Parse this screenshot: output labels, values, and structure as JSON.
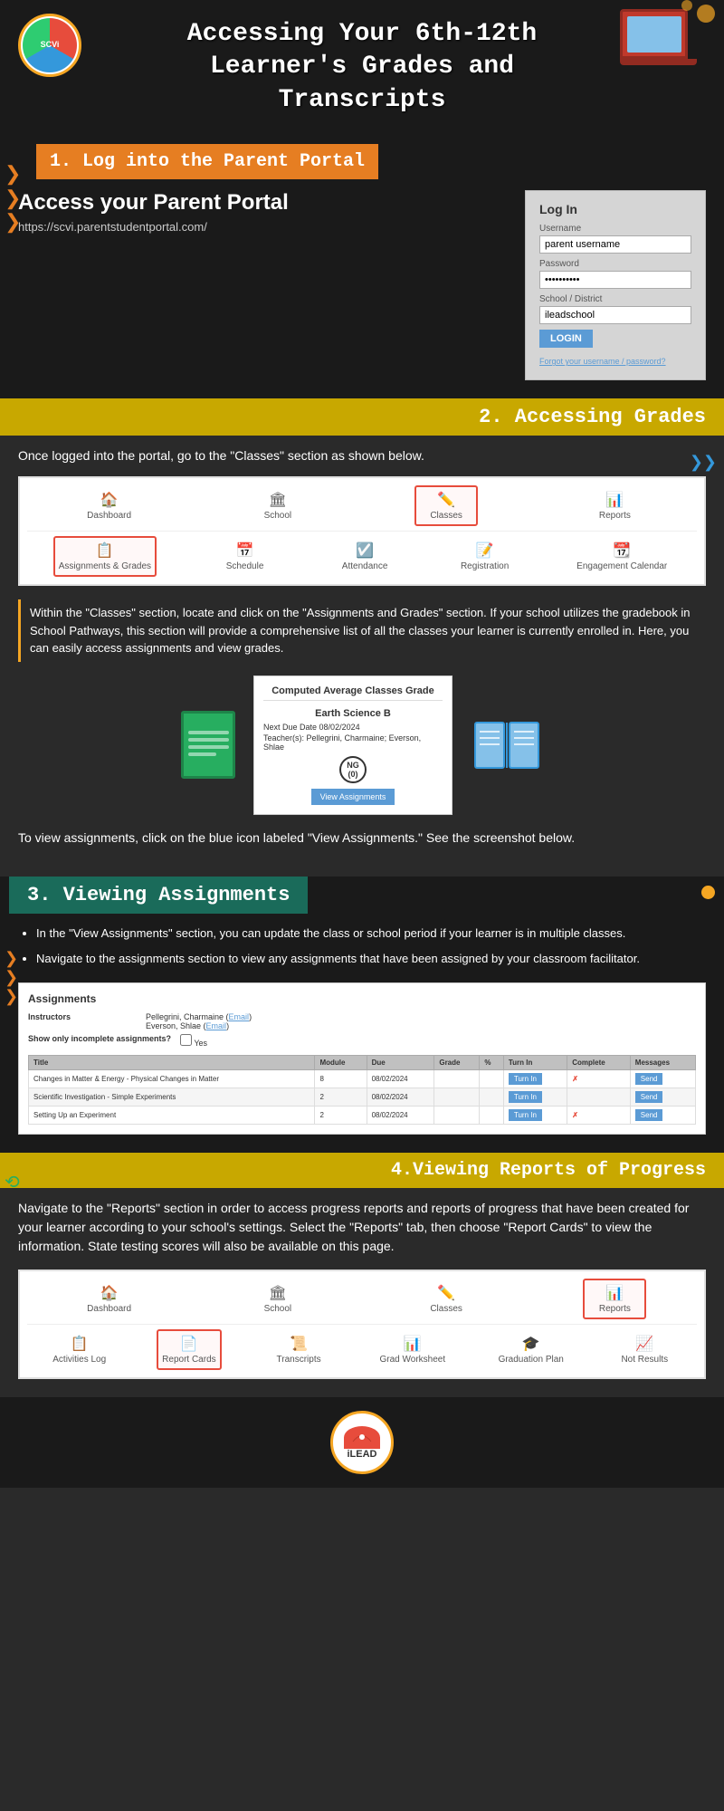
{
  "header": {
    "title": "Accessing Your 6th-12th\nLearner's Grades and\nTranscripts",
    "logo_text": "SCVi"
  },
  "section1": {
    "heading": "1. Log into the Parent Portal",
    "subtitle": "Access your Parent Portal",
    "url": "https://scvi.parentstudentportal.com/",
    "login_box": {
      "title": "Log In",
      "username_label": "Username",
      "username_value": "parent username",
      "password_label": "Password",
      "password_value": "••••••••••",
      "school_label": "School / District",
      "school_value": "ileadschool",
      "login_btn": "LOGIN",
      "forgot_link": "Forgot your username / password?"
    }
  },
  "section2": {
    "heading": "2. Accessing Grades",
    "instruction1": "Once logged into the portal, go to the \"Classes\" section as shown below.",
    "nav_items": [
      {
        "label": "Dashboard",
        "icon": "🏠"
      },
      {
        "label": "School",
        "icon": "🏛"
      },
      {
        "label": "Classes",
        "icon": "✏️",
        "highlighted": true
      },
      {
        "label": "Reports",
        "icon": "📊"
      }
    ],
    "nav_items_row2": [
      {
        "label": "Assignments & Grades",
        "icon": "📋",
        "highlighted": true
      },
      {
        "label": "Schedule",
        "icon": "📅"
      },
      {
        "label": "Attendance",
        "icon": "☑️"
      },
      {
        "label": "Registration",
        "icon": "📝"
      },
      {
        "label": "Engagement Calendar",
        "icon": "📆"
      }
    ],
    "instruction2": "Within the \"Classes\" section, locate and click on the \"Assignments and Grades\" section. If your school utilizes the gradebook in School Pathways, this section will provide a comprehensive list of all the classes your learner is currently enrolled in. Here, you can easily access assignments and view  grades.",
    "grade_card": {
      "title": "Computed Average Classes Grade",
      "subject": "Earth Science B",
      "due_date_label": "Next Due Date",
      "due_date": "08/02/2024",
      "teachers_label": "Teacher(s)",
      "teachers": "Pellegrini, Charmaine; Everson, Shlae",
      "grade": "NG",
      "grade_sub": "(0)",
      "view_btn": "View Assignments"
    },
    "instruction3": "To view assignments, click on the blue icon labeled \"View Assignments.\" See the screenshot below."
  },
  "section3": {
    "heading": "3. Viewing Assignments",
    "bullets": [
      "In the \"View Assignments\" section, you can update the class or school period if your learner is in multiple classes.",
      "Navigate to the assignments section to view any assignments that have been assigned by your classroom facilitator."
    ],
    "assignments_table": {
      "title": "Assignments",
      "instructors_label": "Instructors",
      "instructors_value": "Pellegrini, Charmaine (Email)\nEverson, Shlae (Email)",
      "show_incomplete_label": "Show only incomplete assignments?",
      "show_incomplete_value": "Yes",
      "columns": [
        "Title",
        "Module",
        "Due",
        "Grade",
        "%",
        "Turn In",
        "Complete",
        "Messages"
      ],
      "rows": [
        {
          "title": "Changes in Matter & Energy - Physical Changes in Matter",
          "module": "8",
          "due": "08/02/2024",
          "grade": "",
          "percent": "",
          "turn_in": "Turn In",
          "complete": "✗",
          "messages": "Send"
        },
        {
          "title": "Scientific Investigation - Simple Experiments",
          "module": "2",
          "due": "08/02/2024",
          "grade": "",
          "percent": "",
          "turn_in": "Turn In",
          "complete": "",
          "messages": "Send"
        },
        {
          "title": "Setting Up an Experiment",
          "module": "2",
          "due": "08/02/2024",
          "grade": "",
          "percent": "",
          "turn_in": "Turn In",
          "complete": "✗",
          "messages": "Send"
        }
      ]
    }
  },
  "section4": {
    "heading": "4.Viewing Reports of Progress",
    "instruction": "Navigate to the \"Reports\" section in order to access progress reports and reports of progress that have been created for your learner according to your school's settings. Select the \"Reports\" tab, then choose \"Report Cards\" to view the information. State testing scores will also be available on this page.",
    "nav_items": [
      {
        "label": "Dashboard",
        "icon": "🏠"
      },
      {
        "label": "School",
        "icon": "🏛"
      },
      {
        "label": "Classes",
        "icon": "✏️"
      },
      {
        "label": "Reports",
        "icon": "📊",
        "highlighted": true
      }
    ],
    "nav_items_row2": [
      {
        "label": "Activities Log",
        "icon": "📋"
      },
      {
        "label": "Report Cards",
        "icon": "📄",
        "highlighted": true
      },
      {
        "label": "Transcripts",
        "icon": "📜"
      },
      {
        "label": "Grad Worksheet",
        "icon": "📊"
      },
      {
        "label": "Graduation Plan",
        "icon": "🎓"
      },
      {
        "label": "Not Results",
        "icon": "📈"
      }
    ]
  },
  "footer": {
    "logo_text": "iLEAD"
  }
}
